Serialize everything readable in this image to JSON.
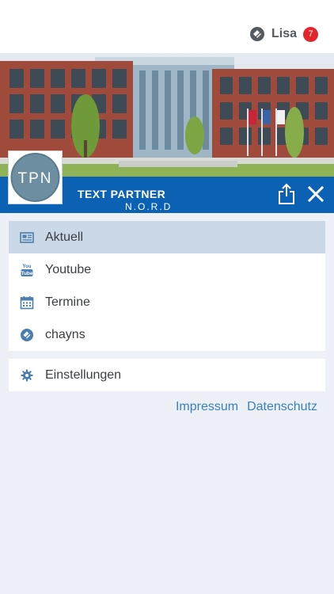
{
  "header": {
    "user_name": "Lisa",
    "notification_count": "7"
  },
  "brand": {
    "logo_text": "TPN",
    "title": "TEXT PARTNER",
    "subtitle": "N.O.R.D"
  },
  "menu": {
    "items": [
      {
        "label": "Aktuell",
        "icon": "newspaper-icon",
        "active": true
      },
      {
        "label": "Youtube",
        "icon": "youtube-icon",
        "active": false
      },
      {
        "label": "Termine",
        "icon": "calendar-icon",
        "active": false
      },
      {
        "label": "chayns",
        "icon": "chayns-icon",
        "active": false
      }
    ]
  },
  "settings": {
    "label": "Einstellungen",
    "icon": "gear-icon"
  },
  "footer": {
    "impressum": "Impressum",
    "datenschutz": "Datenschutz"
  },
  "colors": {
    "brand_blue": "#0b62b5",
    "badge_red": "#e2262c",
    "active_item_bg": "#cbd8e6",
    "link_blue": "#3b80c2"
  }
}
